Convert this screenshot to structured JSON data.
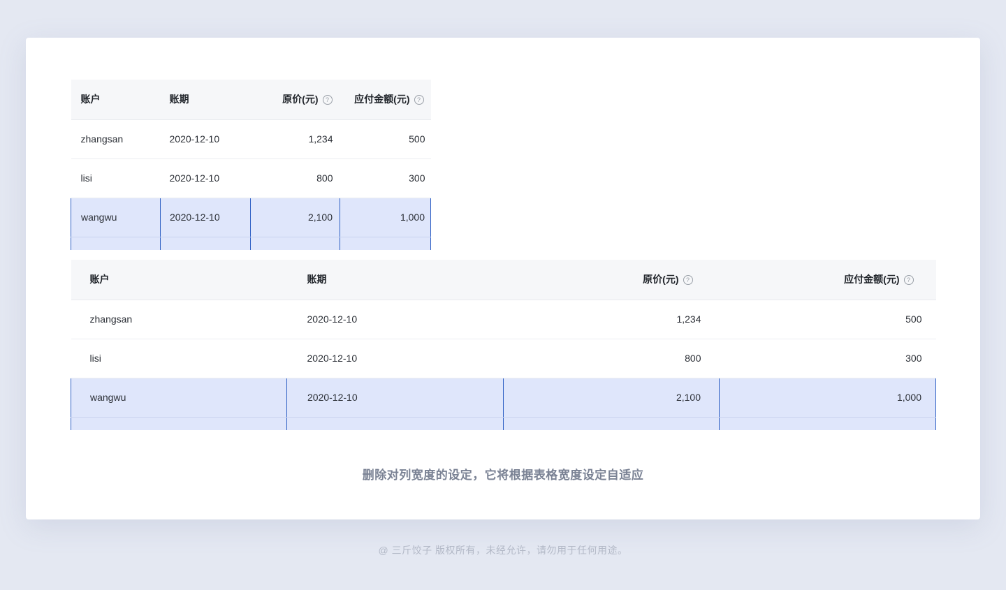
{
  "table1": {
    "columns": {
      "account": "账户",
      "period": "账期",
      "original_price": "原价(元)",
      "payable_amount": "应付金额(元)"
    },
    "rows": [
      {
        "account": "zhangsan",
        "period": "2020-12-10",
        "original_price": "1,234",
        "payable_amount": "500"
      },
      {
        "account": "lisi",
        "period": "2020-12-10",
        "original_price": "800",
        "payable_amount": "300"
      },
      {
        "account": "wangwu",
        "period": "2020-12-10",
        "original_price": "2,100",
        "payable_amount": "1,000"
      }
    ]
  },
  "table2": {
    "columns": {
      "account": "账户",
      "period": "账期",
      "original_price": "原价(元)",
      "payable_amount": "应付金额(元)"
    },
    "rows": [
      {
        "account": "zhangsan",
        "period": "2020-12-10",
        "original_price": "1,234",
        "payable_amount": "500"
      },
      {
        "account": "lisi",
        "period": "2020-12-10",
        "original_price": "800",
        "payable_amount": "300"
      },
      {
        "account": "wangwu",
        "period": "2020-12-10",
        "original_price": "2,100",
        "payable_amount": "1,000"
      }
    ]
  },
  "help_icon_glyph": "?",
  "selection_color": "#2d5fc4",
  "selection_fill": "#dfe6fb",
  "caption": "删除对列宽度的设定，它将根据表格宽度设定自适应",
  "footer": "@ 三斤饺子   版权所有，未经允许，请勿用于任何用途。"
}
